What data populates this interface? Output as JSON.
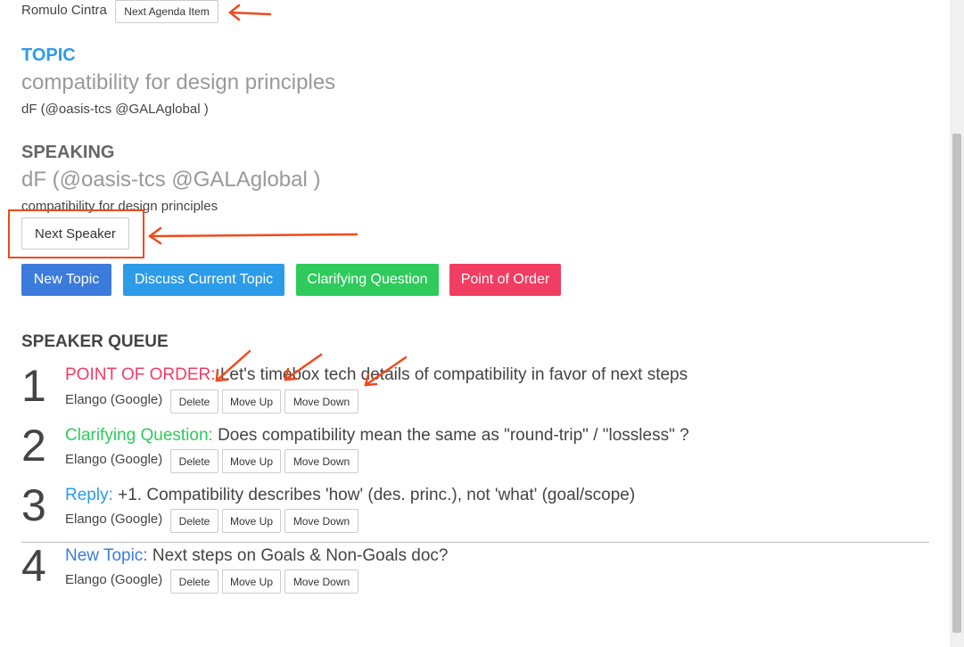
{
  "chair": {
    "name": "Romulo Cintra",
    "next_agenda_label": "Next Agenda Item"
  },
  "topic": {
    "heading": "TOPIC",
    "title": "compatibility for design principles",
    "owner": "dF (@oasis-tcs @GALAglobal )"
  },
  "speaking": {
    "heading": "SPEAKING",
    "speaker": "dF (@oasis-tcs @GALAglobal )",
    "topic": "compatibility for design principles",
    "next_speaker_label": "Next Speaker"
  },
  "actions": [
    {
      "label": "New Topic",
      "color": "#3b7bdc"
    },
    {
      "label": "Discuss Current Topic",
      "color": "#2d9ce8"
    },
    {
      "label": "Clarifying Question",
      "color": "#2ecb5c"
    },
    {
      "label": "Point of Order",
      "color": "#f23d63"
    }
  ],
  "queue": {
    "heading": "SPEAKER QUEUE",
    "buttons": {
      "delete": "Delete",
      "up": "Move Up",
      "down": "Move Down"
    },
    "items": [
      {
        "num": "1",
        "type": "POINT OF ORDER:",
        "type_color": "#f23d63",
        "text": "Let's timebox tech details of compatibility in favor of next steps",
        "who": "Elango (Google)"
      },
      {
        "num": "2",
        "type": "Clarifying Question:",
        "type_color": "#2ecb5c",
        "text": "Does compatibility mean the same as \"round-trip\" / \"lossless\" ?",
        "who": "Elango (Google)"
      },
      {
        "num": "3",
        "type": "Reply:",
        "type_color": "#2d9ce8",
        "text": "+1. Compatibility describes 'how' (des. princ.), not 'what' (goal/scope)",
        "who": "Elango (Google)"
      },
      {
        "num": "4",
        "type": "New Topic:",
        "type_color": "#3b7bdc",
        "text": "Next steps on Goals & Non-Goals doc?",
        "who": "Elango (Google)"
      }
    ]
  }
}
